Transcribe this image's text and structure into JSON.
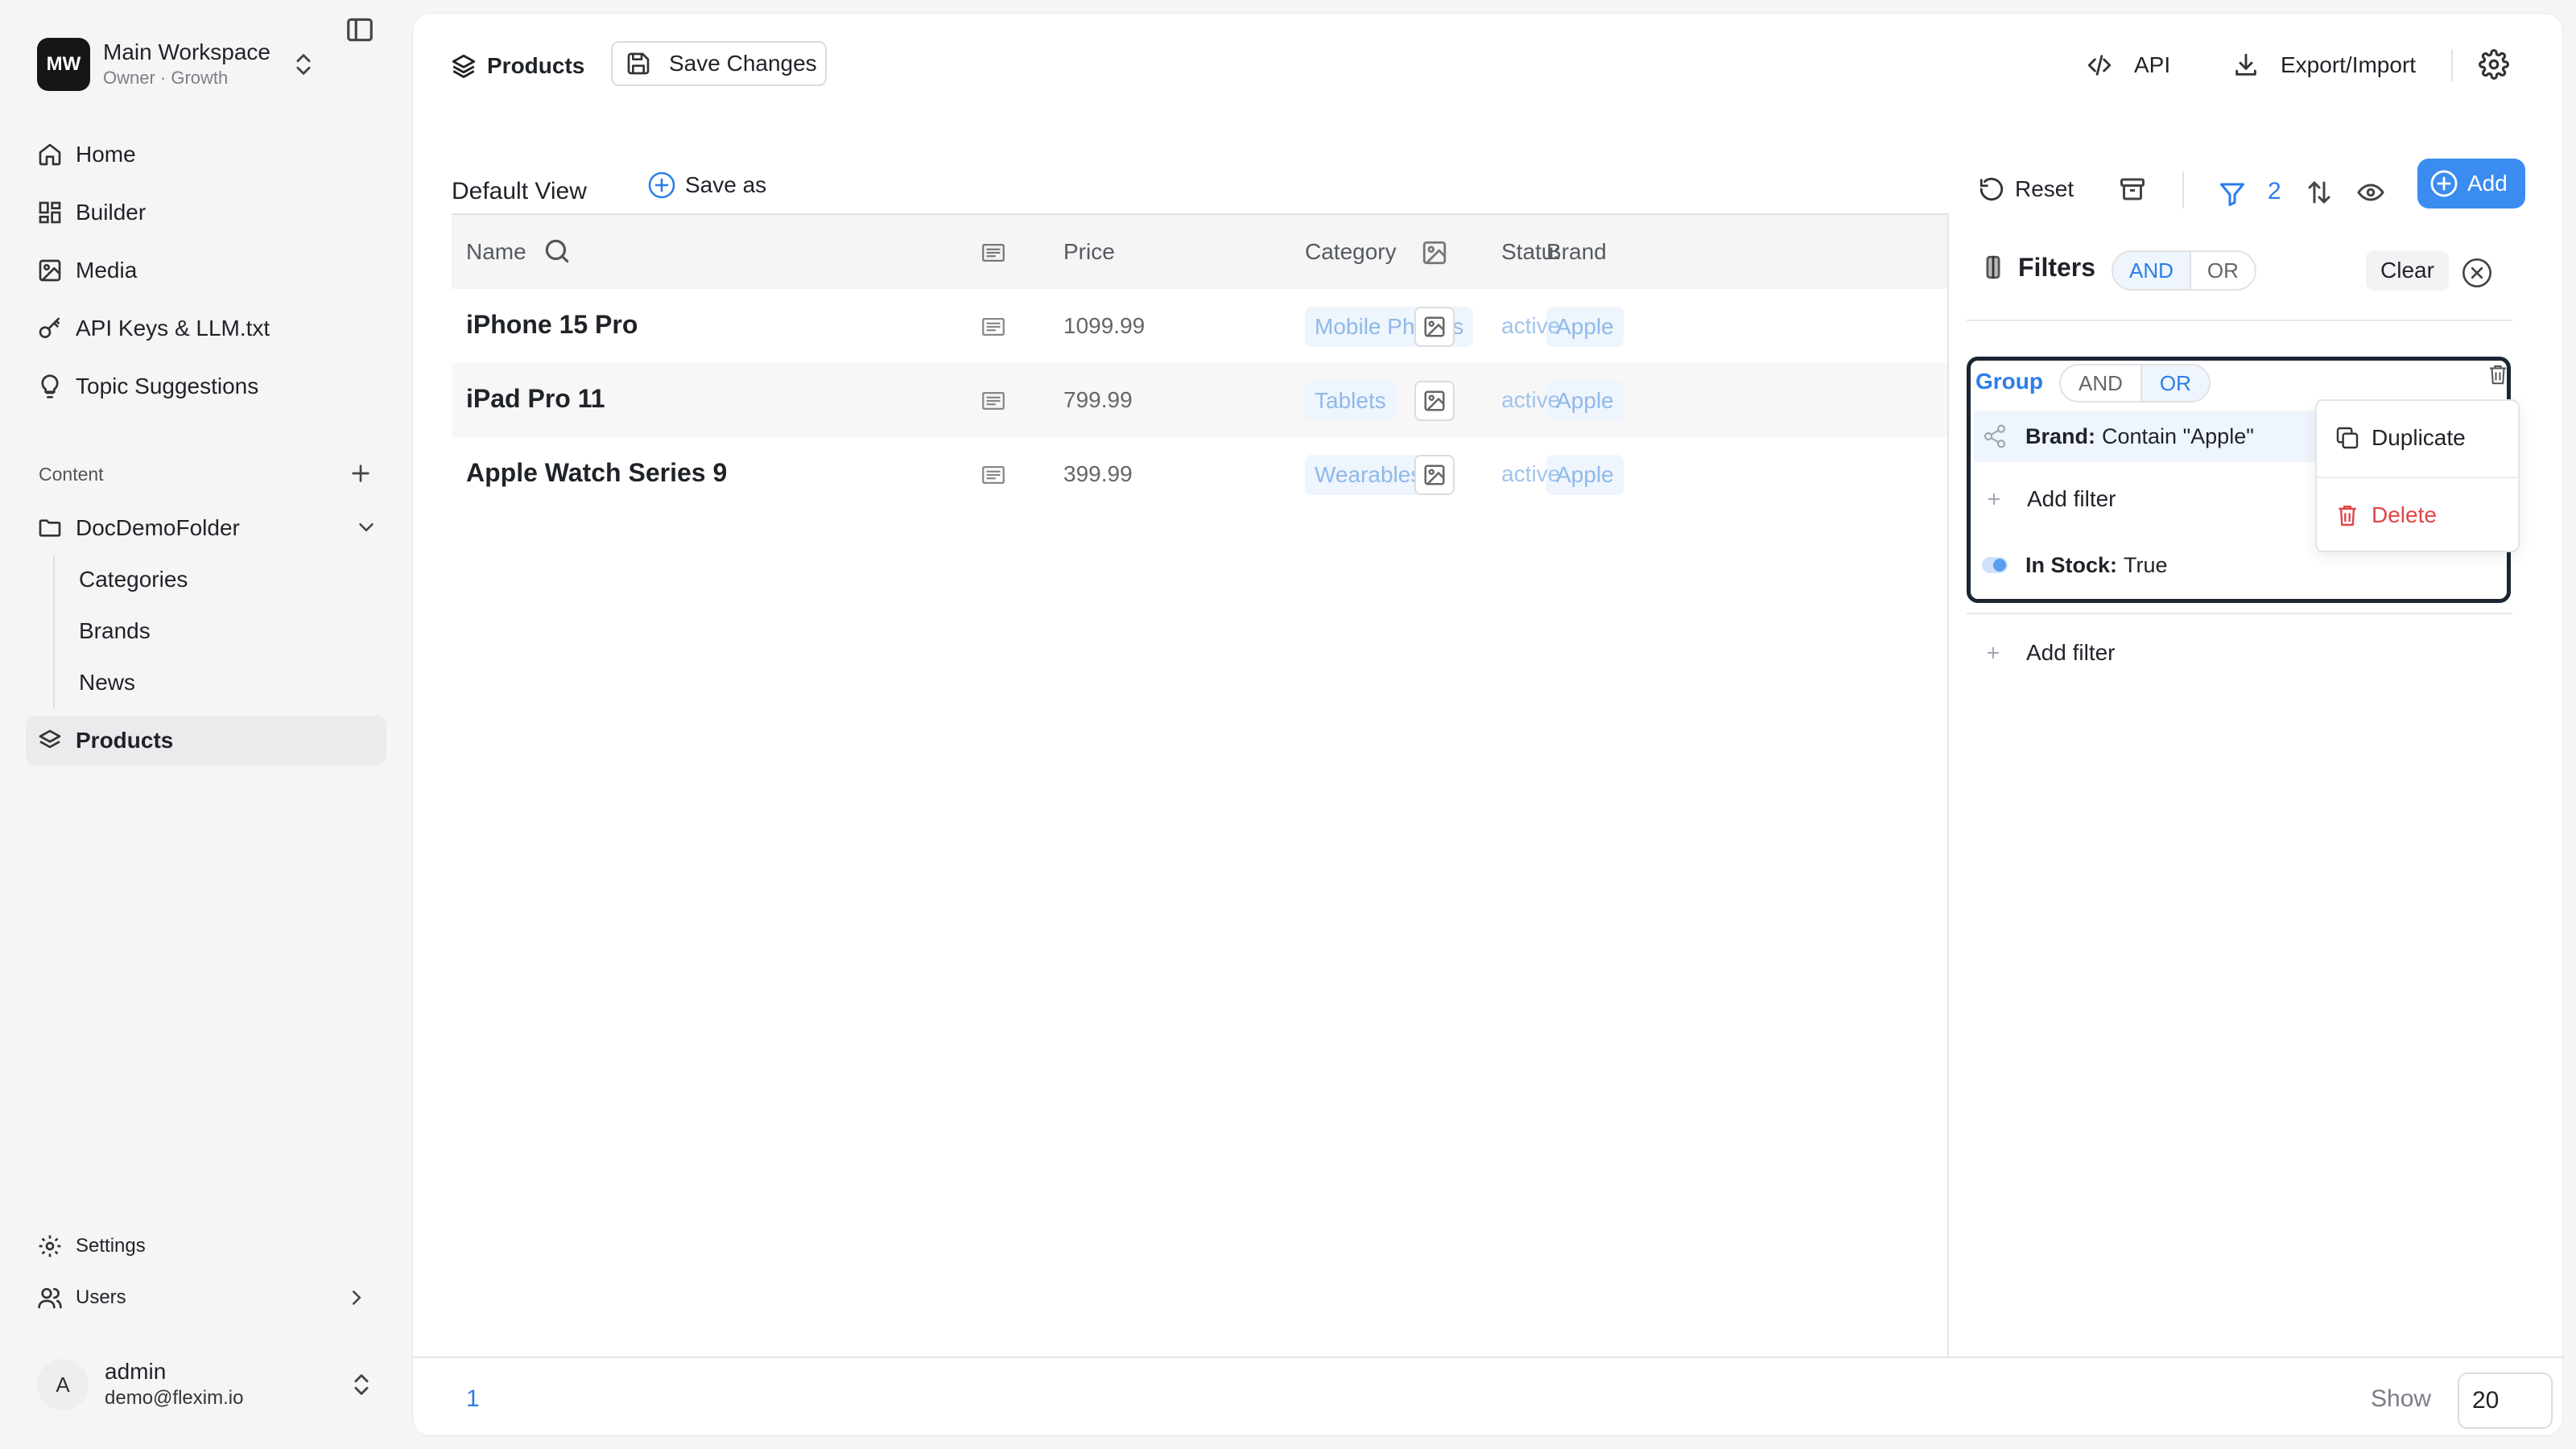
{
  "workspace": {
    "initials": "MW",
    "name": "Main Workspace",
    "subtitle": "Owner · Growth"
  },
  "nav": {
    "home": "Home",
    "builder": "Builder",
    "media": "Media",
    "api_keys": "API Keys & LLM.txt",
    "topic_suggestions": "Topic Suggestions"
  },
  "content_section": {
    "label": "Content",
    "folder": "DocDemoFolder",
    "children": [
      "Categories",
      "Brands",
      "News"
    ],
    "products": "Products"
  },
  "bottom_nav": {
    "settings": "Settings",
    "users": "Users"
  },
  "user": {
    "initial": "A",
    "name": "admin",
    "email": "demo@flexim.io"
  },
  "topbar": {
    "title": "Products",
    "save_changes": "Save Changes",
    "api": "API",
    "export_import": "Export/Import"
  },
  "view": {
    "tab": "Default View",
    "save_as": "Save as",
    "reset": "Reset",
    "filter_count": "2",
    "add": "Add"
  },
  "table": {
    "columns": {
      "name": "Name",
      "price": "Price",
      "category": "Category",
      "brand": "Brand",
      "status": "Status"
    },
    "rows": [
      {
        "name": "iPhone 15 Pro",
        "price": "1099.99",
        "category": "Mobile Phones",
        "brand": "Apple",
        "status": "active"
      },
      {
        "name": "iPad Pro 11",
        "price": "799.99",
        "category": "Tablets",
        "brand": "Apple",
        "status": "active"
      },
      {
        "name": "Apple Watch Series 9",
        "price": "399.99",
        "category": "Wearables",
        "brand": "Apple",
        "status": "active"
      }
    ]
  },
  "filters": {
    "title": "Filters",
    "and": "AND",
    "or": "OR",
    "root_mode": "AND",
    "clear": "Clear",
    "group": {
      "label": "Group",
      "mode": "OR",
      "conditions": [
        {
          "field": "Brand:",
          "value": "Contain \"Apple\""
        },
        {
          "field": "In Stock:",
          "value": "True"
        }
      ],
      "add_filter": "Add filter"
    },
    "add_filter": "Add filter",
    "context_menu": {
      "duplicate": "Duplicate",
      "delete": "Delete"
    }
  },
  "footer": {
    "page": "1",
    "show_label": "Show",
    "page_size": "20"
  },
  "colors": {
    "accent": "#2b7de9",
    "danger": "#e0454a",
    "dark": "#161616"
  }
}
